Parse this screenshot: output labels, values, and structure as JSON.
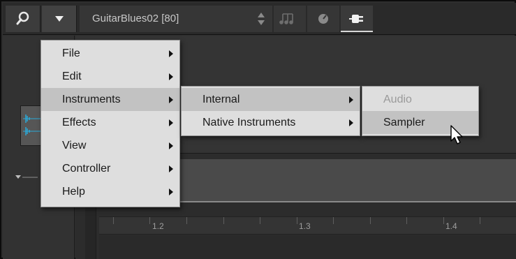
{
  "toolbar": {
    "sound_name": "GuitarBlues02 [80]",
    "icons": [
      "search-icon",
      "chevron-down-icon",
      "up-down-stepper-icon",
      "notes-icon",
      "knob-icon",
      "plug-icon"
    ]
  },
  "menus": {
    "main": {
      "items": [
        {
          "label": "File",
          "has_submenu": true
        },
        {
          "label": "Edit",
          "has_submenu": true
        },
        {
          "label": "Instruments",
          "has_submenu": true,
          "active": true
        },
        {
          "label": "Effects",
          "has_submenu": true
        },
        {
          "label": "View",
          "has_submenu": true
        },
        {
          "label": "Controller",
          "has_submenu": true
        },
        {
          "label": "Help",
          "has_submenu": true
        }
      ]
    },
    "instruments": {
      "items": [
        {
          "label": "Internal",
          "has_submenu": true,
          "active": true
        },
        {
          "label": "Native Instruments",
          "has_submenu": true
        }
      ]
    },
    "internal": {
      "items": [
        {
          "label": "Audio",
          "disabled": true
        },
        {
          "label": "Sampler",
          "active": true
        }
      ]
    }
  },
  "ruler": {
    "labels": [
      "1.2",
      "1.3",
      "1.4"
    ]
  },
  "colors": {
    "menu_background": "#dedede",
    "menu_highlight": "#c2c2c2",
    "toolbar_background": "#2a2a2a",
    "waveform": "#2aa9d8"
  }
}
